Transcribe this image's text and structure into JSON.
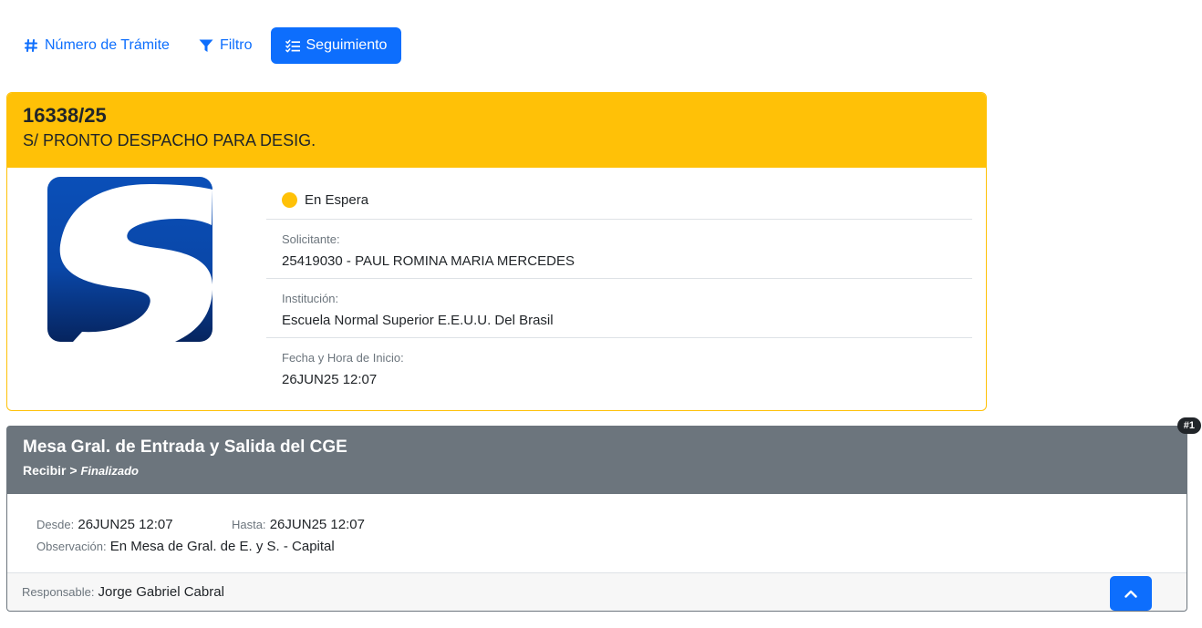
{
  "nav": {
    "numero_label": "Número de Trámite",
    "filtro_label": "Filtro",
    "seguimiento_label": "Seguimiento"
  },
  "tramite": {
    "number": "16338/25",
    "title": "S/ PRONTO DESPACHO PARA DESIG.",
    "status": "En Espera",
    "status_color": "#ffc107",
    "solicitante_label": "Solicitante:",
    "solicitante": "25419030 - PAUL ROMINA MARIA MERCEDES",
    "institucion_label": "Institución:",
    "institucion": "Escuela Normal Superior E.E.U.U. Del Brasil",
    "fecha_label": "Fecha y Hora de Inicio:",
    "fecha": "26JUN25 12:07"
  },
  "step": {
    "badge": "#1",
    "title": "Mesa Gral. de Entrada y Salida del CGE",
    "action": "Recibir",
    "separator": ">",
    "state": "Finalizado",
    "desde_label": "Desde:",
    "desde": "26JUN25 12:07",
    "hasta_label": "Hasta:",
    "hasta": "26JUN25 12:07",
    "observacion_label": "Observación:",
    "observacion": "En Mesa de Gral. de E. y S. - Capital",
    "responsable_label": "Responsable:",
    "responsable": "Jorge Gabriel Cabral"
  },
  "colors": {
    "primary": "#0d6efd",
    "warning": "#ffc107",
    "secondary": "#6c757d"
  },
  "icons": {
    "numero": "hash-icon",
    "filtro": "filter-icon",
    "seguimiento": "list-check-icon",
    "scroll_top": "chevron-up-icon"
  }
}
